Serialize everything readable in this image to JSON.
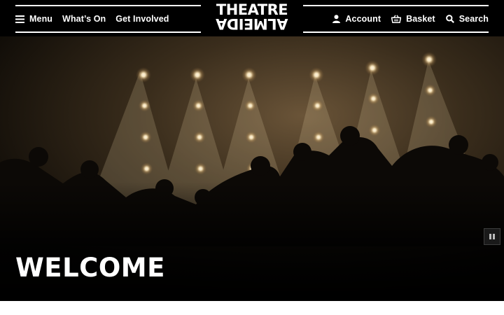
{
  "header": {
    "menu_label": "Menu",
    "whats_on_label": "What’s On",
    "get_involved_label": "Get Involved",
    "logo_line1": "THEATRE",
    "logo_line2": "ALMEIDA",
    "account_label": "Account",
    "basket_label": "Basket",
    "search_label": "Search"
  },
  "hero": {
    "heading": "WELCOME",
    "media_control": "pause-icon"
  },
  "icons": {
    "menu": "menu-icon",
    "account": "user-icon",
    "basket": "basket-icon",
    "search": "search-icon"
  },
  "colors": {
    "header_bg": "#000000",
    "text": "#ffffff",
    "light_glow": "#f2e2c0"
  }
}
